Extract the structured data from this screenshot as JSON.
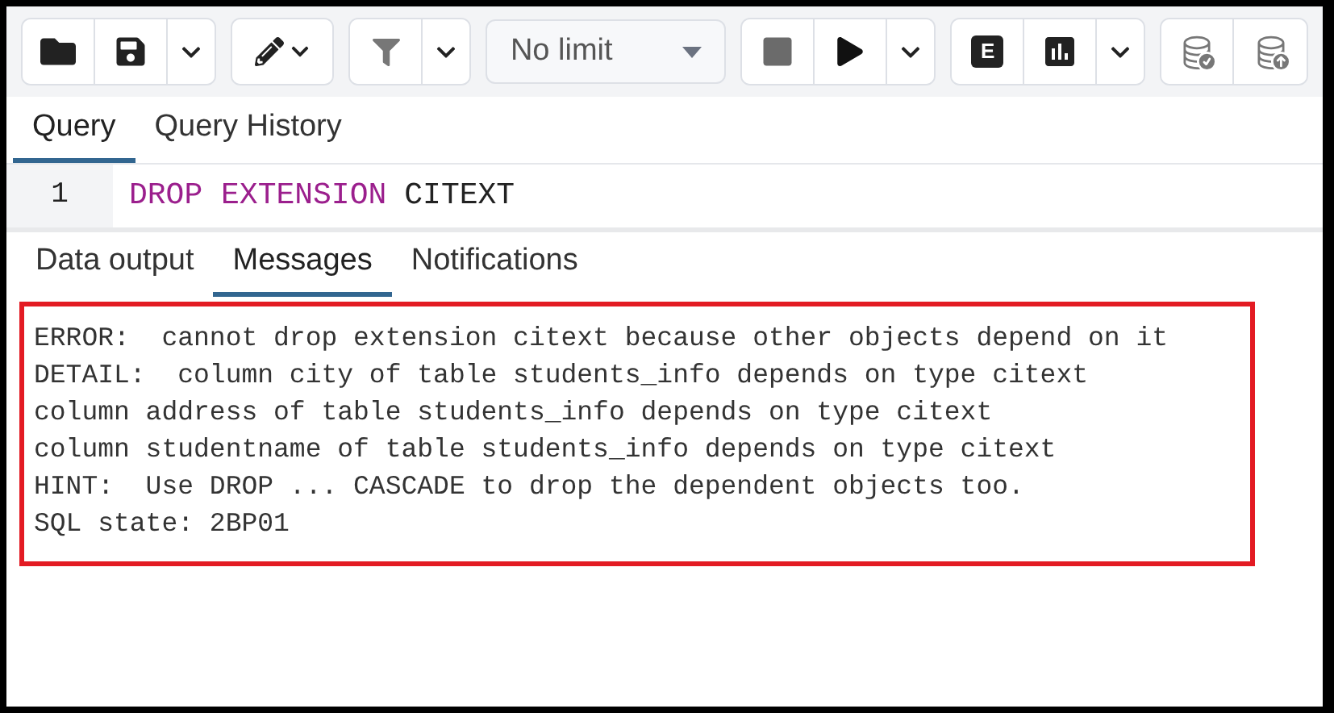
{
  "toolbar": {
    "explain_label": "E",
    "row_limit": "No limit"
  },
  "editor_tabs": [
    {
      "label": "Query",
      "selected": true
    },
    {
      "label": "Query History",
      "selected": false
    }
  ],
  "editor": {
    "lines": [
      {
        "number": "1",
        "tokens": [
          {
            "kind": "keyword",
            "text": "DROP EXTENSION"
          },
          {
            "kind": "identifier",
            "text": "CITEXT"
          }
        ]
      }
    ]
  },
  "output_tabs": [
    {
      "label": "Data output",
      "selected": false
    },
    {
      "label": "Messages",
      "selected": true
    },
    {
      "label": "Notifications",
      "selected": false
    }
  ],
  "messages": {
    "highlighted": true,
    "lines": [
      "ERROR:  cannot drop extension citext because other objects depend on it",
      "DETAIL:  column city of table students_info depends on type citext",
      "column address of table students_info depends on type citext",
      "column studentname of table students_info depends on type citext",
      "HINT:  Use DROP ... CASCADE to drop the dependent objects too.",
      "SQL state: 2BP01"
    ]
  }
}
